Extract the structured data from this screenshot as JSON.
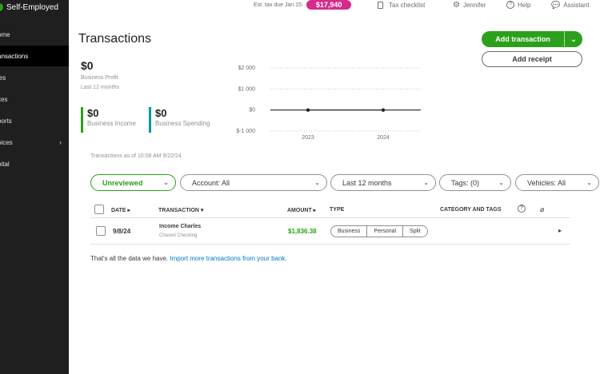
{
  "sidebar": {
    "brand": "Self-Employed",
    "items": [
      {
        "label": "ome"
      },
      {
        "label": "ansactions"
      },
      {
        "label": "les"
      },
      {
        "label": "xes"
      },
      {
        "label": "ports"
      },
      {
        "label": "oices"
      },
      {
        "label": "pital"
      }
    ]
  },
  "topbar": {
    "tax_due_label": "Est. tax due Jan 15:",
    "tax_due_amount": "$17,940",
    "tax_checklist": "Tax checklist",
    "user": "Jennifer",
    "help": "Help",
    "assistant": "Assistant"
  },
  "page": {
    "title": "Transactions",
    "add_transaction": "Add transaction",
    "add_receipt": "Add receipt"
  },
  "summary": {
    "profit_value": "$0",
    "profit_label": "Business Profit",
    "period": "Last 12 months",
    "income_value": "$0",
    "income_label": "Business Income",
    "spending_value": "$0",
    "spending_label": "Business Spending",
    "as_of": "Transactions as of 10:08 AM 9/22/24"
  },
  "chart_data": {
    "type": "line",
    "x": [
      "2023",
      "2024"
    ],
    "series": [
      {
        "values": [
          0,
          0
        ]
      }
    ],
    "yticks": [
      "$2 000",
      "$1 000",
      "$0",
      "$-1 000"
    ],
    "ylim": [
      -1000,
      2000
    ],
    "grid": true
  },
  "filters": {
    "status": "Unreviewed",
    "account": "Account: All",
    "period": "Last 12 months",
    "tags": "Tags: (0)",
    "vehicles": "Vehicles: All"
  },
  "table": {
    "headers": {
      "date": "DATE",
      "transaction": "TRANSACTION",
      "amount": "AMOUNT",
      "type": "TYPE",
      "category": "CATEGORY AND TAGS"
    },
    "rows": [
      {
        "date": "9/8/24",
        "name": "Income Charles",
        "account": "Chased Checking",
        "amount": "$1,836.38",
        "types": [
          "Business",
          "Personal",
          "Split"
        ]
      }
    ]
  },
  "footer": {
    "note": "That's all the data we have.",
    "link": "Import more transactions from your bank."
  },
  "colors": {
    "primary_green": "#2ca01c",
    "tax_pill": "#d52b8c",
    "spending_bar": "#0097a7",
    "sidebar_bg": "#1f1f1f"
  }
}
